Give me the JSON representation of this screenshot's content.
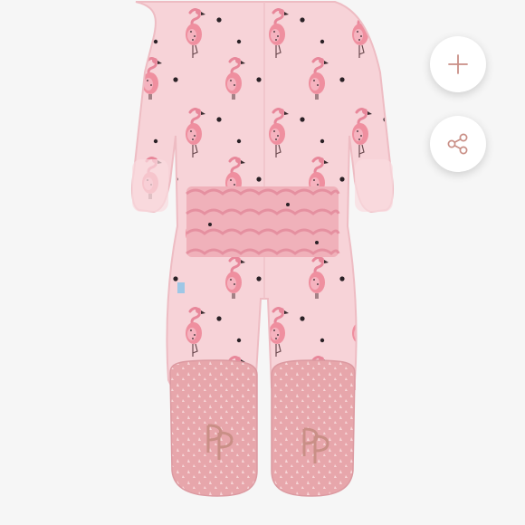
{
  "viewer": {
    "image_subject": "baby-footie-pajama-flamingo-print",
    "colors": {
      "background": "#f6f6f6",
      "garment": "#f7d3d8",
      "garment_shadow": "#efc1c7",
      "ruffle": "#eda3ad",
      "sole": "#e7a6ab",
      "flamingo": "#ef8f9f",
      "dot": "#2a2126",
      "accent": "#c98f86"
    }
  },
  "actions": {
    "add": {
      "icon": "plus-icon"
    },
    "share": {
      "icon": "share-icon"
    }
  }
}
